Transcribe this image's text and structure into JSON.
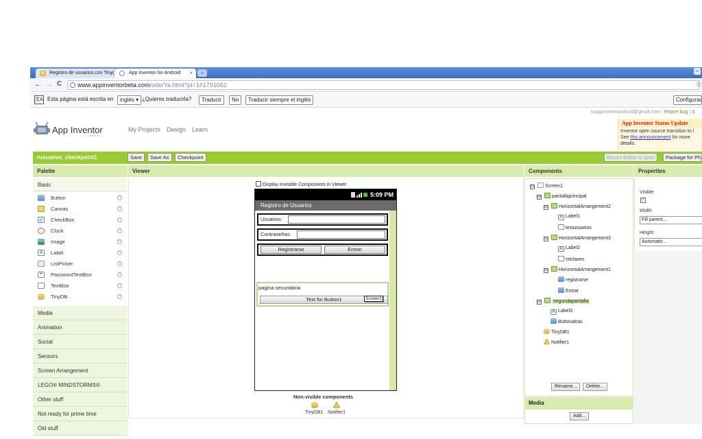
{
  "browser": {
    "tabs": [
      {
        "title": "Registro de usuarios con Tiny(",
        "active": false
      },
      {
        "title": "App Inventor for Android",
        "active": true
      }
    ],
    "new_tab": "+",
    "window_min": "–",
    "back": "←",
    "forward": "→",
    "reload": "C",
    "url_host": "www.appinventorbeta.com",
    "url_path": "/ode/Ya.html?pl=1#1791062",
    "star": "☆"
  },
  "translate_bar": {
    "icon": "文A",
    "message": "Esta página está escrita en",
    "language": "inglés ▾",
    "question": "¿Quieres traducirla?",
    "translate_btn": "Traducir",
    "no_btn": "No",
    "always_btn": "Traducir siempre el inglés",
    "settings_btn": "Configurac"
  },
  "header": {
    "user": "tuappinvetorandroid@gmail.com",
    "sep1": "|",
    "report_bug": "Report bug",
    "sep2": "|",
    "more": "S",
    "app_name": "App Inventor",
    "beta": "BETA",
    "nav": [
      "My Projects",
      "Design",
      "Learn"
    ]
  },
  "status_update": {
    "title": "App Inventor Status Update",
    "line1": "Inventor open source transition to l",
    "line2_pre": "See",
    "link": "this announcement",
    "line2_post": "for more",
    "line3": "details."
  },
  "toolbar": {
    "project": "rusuarios_checkpoint1",
    "save": "Save",
    "save_as": "Save As",
    "checkpoint": "Checkpoint",
    "blocks_editor": "Blocks Editor is open",
    "package": "Package for Ph"
  },
  "columns": {
    "palette": "Palette",
    "viewer": "Viewer",
    "components": "Components",
    "properties": "Properties"
  },
  "palette": {
    "basic": "Basic",
    "help_glyph": "?",
    "items": [
      "Button",
      "Canvas",
      "CheckBox",
      "Clock",
      "Image",
      "Label",
      "ListPicker",
      "PasswordTextBox",
      "TextBox",
      "TinyDB"
    ],
    "categories": [
      "Media",
      "Animation",
      "Social",
      "Sensors",
      "Screen Arrangement",
      "LEGO® MINDSTORMS®",
      "Other stuff",
      "Not ready for prime time",
      "Old stuff"
    ]
  },
  "viewer": {
    "display_invisible": "Display Invisible Components in Viewer",
    "time": "5:09 PM",
    "app_title": "Registro de Usuarios",
    "usuarios_label": "Usuarios:",
    "contrasenas_label": "Contraseñas:",
    "registrarse": "Registrarse",
    "entrar": "Entrar",
    "pagina_secundaria": "pagina secundaria",
    "button1": "Text for Button1",
    "screen_tag": "Screen1",
    "nonvisible_title": "Non-visible components",
    "nonvisible": [
      "TinyDB1",
      "Notifier1"
    ]
  },
  "components": {
    "toggle_glyph": "⊟",
    "tree": [
      {
        "name": "Screen1",
        "level": 0,
        "toggle": true
      },
      {
        "name": "pantallaprincipal",
        "level": 1,
        "toggle": true
      },
      {
        "name": "HorizontalArrangement2",
        "level": 2,
        "toggle": true
      },
      {
        "name": "Label1",
        "level": 3,
        "toggle": false
      },
      {
        "name": "textusuarios",
        "level": 3,
        "toggle": false
      },
      {
        "name": "HorizontalArrangement3",
        "level": 2,
        "toggle": true
      },
      {
        "name": "Label2",
        "level": 3,
        "toggle": false
      },
      {
        "name": "txtclaves",
        "level": 3,
        "toggle": false
      },
      {
        "name": "HorizontalArrangement1",
        "level": 2,
        "toggle": true
      },
      {
        "name": "registrarse",
        "level": 3,
        "toggle": false
      },
      {
        "name": "Entrar",
        "level": 3,
        "toggle": false
      },
      {
        "name": "segundapantalla",
        "level": 1,
        "toggle": true,
        "selected": true
      },
      {
        "name": "Label3",
        "level": 2,
        "toggle": false
      },
      {
        "name": "Buttonatras",
        "level": 2,
        "toggle": false
      },
      {
        "name": "TinyDB1",
        "level": 1,
        "toggle": false
      },
      {
        "name": "Notifier1",
        "level": 1,
        "toggle": false
      }
    ],
    "rename": "Rename...",
    "delete": "Delete..."
  },
  "media": {
    "title": "Media",
    "add": "Add..."
  },
  "properties": {
    "visible_label": "Visible",
    "visible_checked": "✓",
    "width_label": "Width",
    "width_value": "Fill parent...",
    "height_label": "Height",
    "height_value": "Automatic..."
  }
}
